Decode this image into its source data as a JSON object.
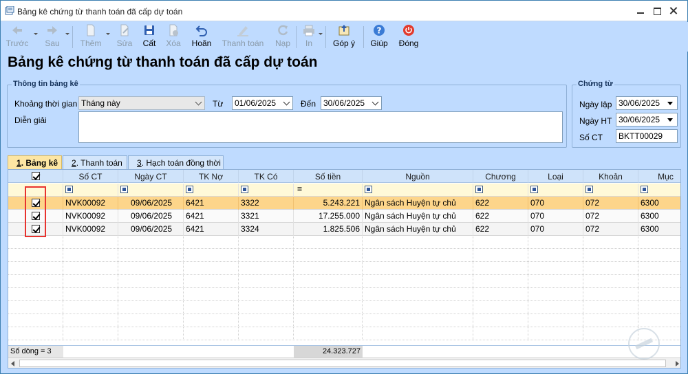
{
  "window": {
    "title": "Bảng kê chứng từ thanh toán đã cấp dự toán"
  },
  "toolbar": {
    "truoc": "Trước",
    "sau": "Sau",
    "them": "Thêm",
    "sua": "Sửa",
    "cat": "Cất",
    "xoa": "Xóa",
    "hoan": "Hoãn",
    "thanh_toan": "Thanh toán",
    "nap": "Nạp",
    "in": "In",
    "gop_y": "Góp ý",
    "giup": "Giúp",
    "dong": "Đóng"
  },
  "page_title": "Bảng kê chứng từ thanh toán đã cấp dự toán",
  "info": {
    "group_title": "Thông tin bảng kê",
    "period_label": "Khoảng thời gian",
    "period_value": "Tháng này",
    "from_label": "Từ",
    "from_value": "01/06/2025",
    "to_label": "Đến",
    "to_value": "30/06/2025",
    "desc_label": "Diễn giải",
    "desc_value": ""
  },
  "voucher": {
    "group_title": "Chứng từ",
    "ngay_lap_label": "Ngày lập",
    "ngay_lap_value": "30/06/2025",
    "ngay_ht_label": "Ngày HT",
    "ngay_ht_value": "30/06/2025",
    "so_ct_label": "Số CT",
    "so_ct_value": "BKTT00029"
  },
  "tabs": [
    {
      "key": "1",
      "label": ". Bảng kê"
    },
    {
      "key": "2",
      "label": ". Thanh toán"
    },
    {
      "key": "3",
      "label": ". Hạch toán đồng thời"
    }
  ],
  "table": {
    "columns": [
      "Số CT",
      "Ngày CT",
      "TK Nợ",
      "TK Có",
      "Số tiền",
      "Nguồn",
      "Chương",
      "Loại",
      "Khoản",
      "Mục"
    ],
    "rows": [
      [
        "NVK00092",
        "09/06/2025",
        "6421",
        "3322",
        "5.243.221",
        "Ngân sách Huyện tự chủ",
        "622",
        "070",
        "072",
        "6300"
      ],
      [
        "NVK00092",
        "09/06/2025",
        "6421",
        "3321",
        "17.255.000",
        "Ngân sách Huyện tự chủ",
        "622",
        "070",
        "072",
        "6300"
      ],
      [
        "NVK00092",
        "09/06/2025",
        "6421",
        "3324",
        "1.825.506",
        "Ngân sách Huyện tự chủ",
        "622",
        "070",
        "072",
        "6300"
      ]
    ],
    "footer_count": "Số dòng = 3",
    "footer_total": "24.323.727"
  }
}
